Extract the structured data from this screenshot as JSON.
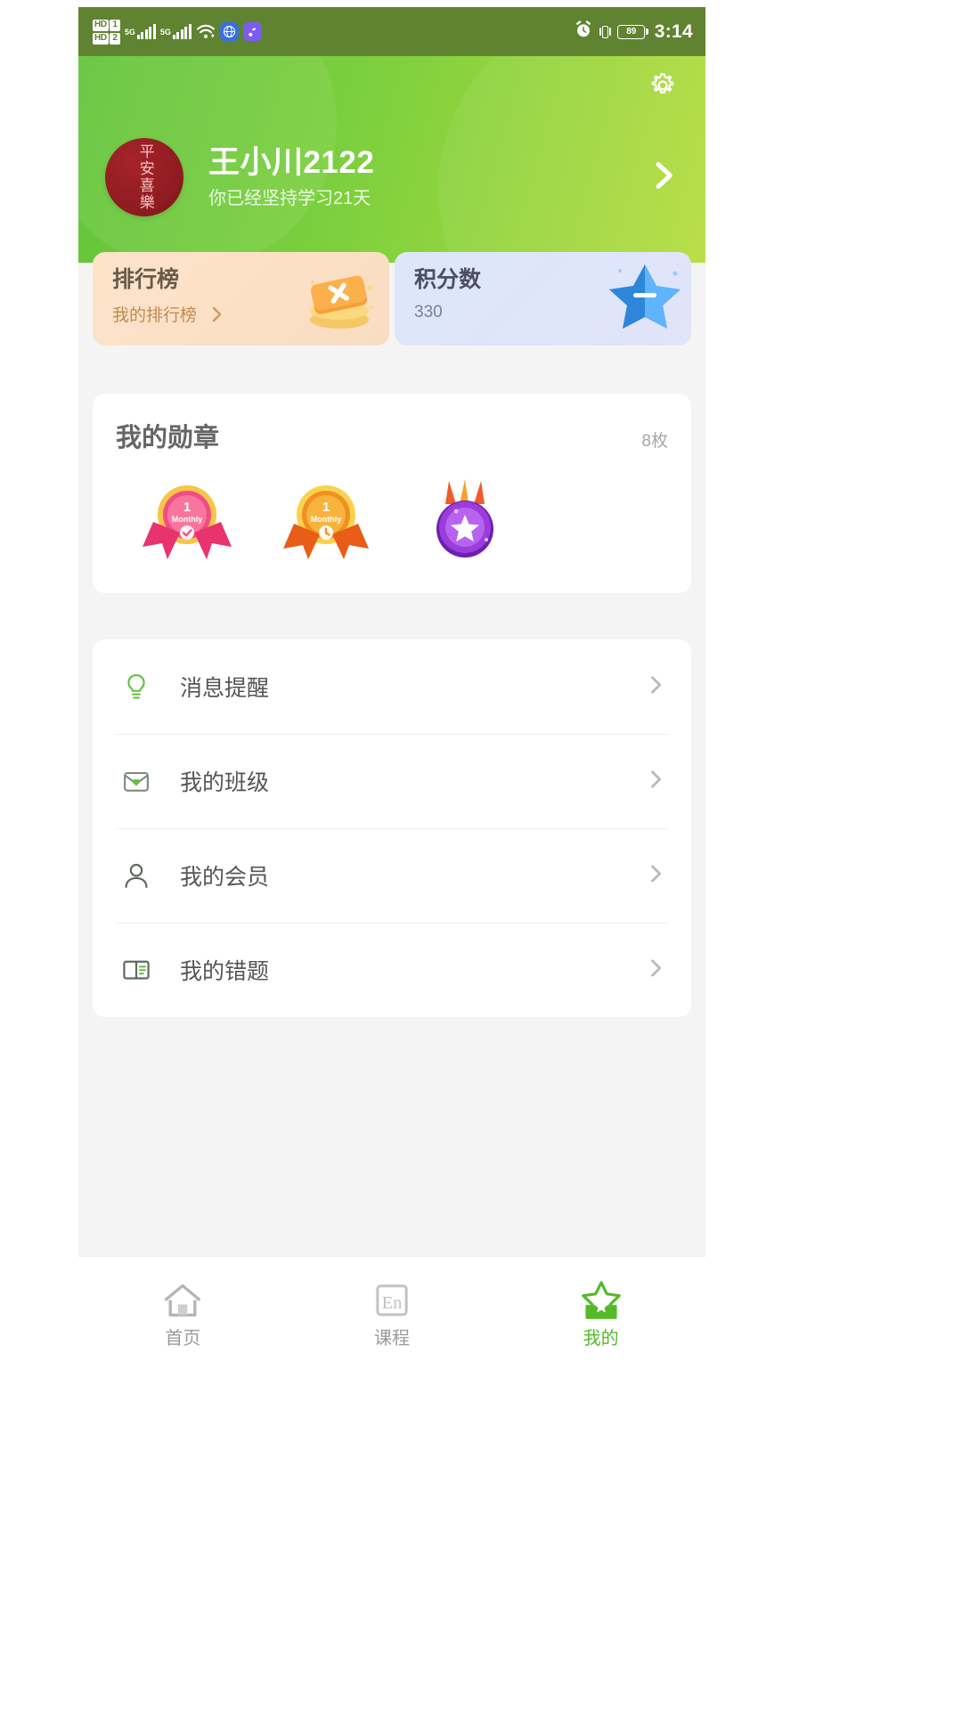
{
  "theme": {
    "status_bg": "#5f8330",
    "header_gradient_from": "#63c43a",
    "header_gradient_to": "#b6dc3f",
    "accent_green": "#55ba2a",
    "page_bg": "#f4f4f4",
    "card_bg": "#ffffff",
    "rank_card_bg": "#fbe0c6",
    "points_card_bg": "#dfe5fa",
    "avatar_bg": "#8c1b20"
  },
  "statusbar": {
    "volte_label_1": "HD",
    "volte_sim_1": "1",
    "volte_label_2": "HD",
    "volte_sim_2": "2",
    "network_1": "5G",
    "network_2": "5G",
    "wifi_icon": "wifi-icon",
    "app_icon_1": "globe-browser-icon",
    "app_icon_2": "music-note-icon",
    "alarm_icon": "alarm-clock-icon",
    "vibrate_icon": "vibrate-icon",
    "battery_percent": "89",
    "time": "3:14"
  },
  "header": {
    "settings_icon": "gear-icon",
    "avatar_name": "avatar",
    "avatar_text": "平安喜樂",
    "username": "王小川2122",
    "streak_text": "你已经坚持学习21天",
    "forward_icon": "chevron-right-icon"
  },
  "stats": [
    {
      "id": "rank",
      "title": "排行榜",
      "subtitle": "我的排行榜",
      "icon": "stacked-cards-icon",
      "chevron_icon": "chevron-right-icon"
    },
    {
      "id": "points",
      "title": "积分数",
      "subtitle": "330",
      "icon": "star-badge-icon"
    }
  ],
  "medals": {
    "title": "我的勋章",
    "count_label": "8枚",
    "items": [
      {
        "name": "medal-monthly-pink",
        "rank": "1",
        "caption": "Monthly",
        "color": "#ef4e83"
      },
      {
        "name": "medal-monthly-orange",
        "rank": "1",
        "caption": "Monthly",
        "color": "#f07a22"
      },
      {
        "name": "medal-star-purple",
        "rank": "",
        "caption": "",
        "color": "#9a3ddb"
      }
    ]
  },
  "menu": [
    {
      "label": "消息提醒",
      "icon": "lightbulb-icon",
      "chevron_icon": "chevron-right-icon"
    },
    {
      "label": "我的班级",
      "icon": "envelope-heart-icon",
      "chevron_icon": "chevron-right-icon"
    },
    {
      "label": "我的会员",
      "icon": "person-icon",
      "chevron_icon": "chevron-right-icon"
    },
    {
      "label": "我的错题",
      "icon": "open-book-icon",
      "chevron_icon": "chevron-right-icon"
    }
  ],
  "tabbar": [
    {
      "label": "首页",
      "icon": "home-icon",
      "active": false
    },
    {
      "label": "课程",
      "icon": "english-course-icon",
      "active": false
    },
    {
      "label": "我的",
      "icon": "star-bookmark-icon",
      "active": true
    }
  ]
}
